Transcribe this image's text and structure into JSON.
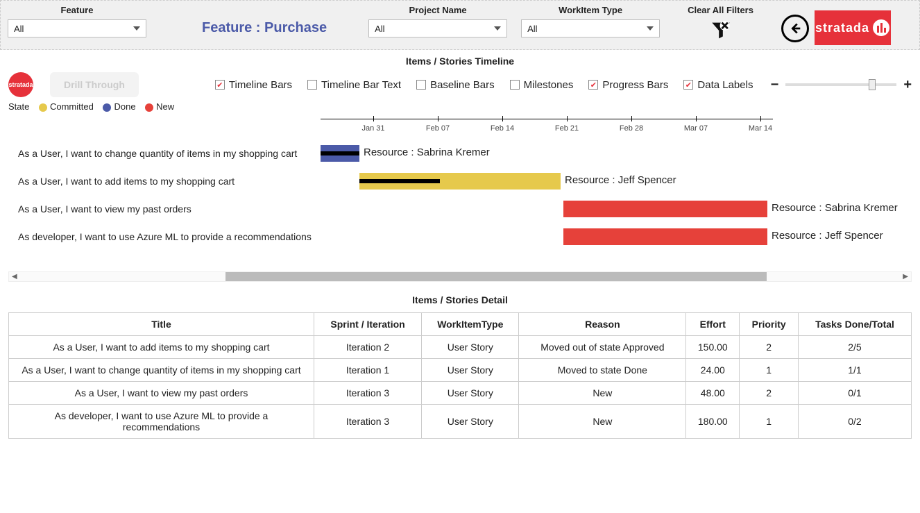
{
  "header": {
    "filters": {
      "feature": {
        "label": "Feature",
        "value": "All"
      },
      "project": {
        "label": "Project Name",
        "value": "All"
      },
      "workitem": {
        "label": "WorkItem Type",
        "value": "All"
      }
    },
    "feature_title": "Feature : Purchase",
    "clear_label": "Clear All Filters",
    "brand": "stratada"
  },
  "timeline": {
    "title": "Items / Stories Timeline",
    "drill_label": "Drill Through",
    "checks": [
      {
        "label": "Timeline Bars",
        "checked": true
      },
      {
        "label": "Timeline Bar Text",
        "checked": false
      },
      {
        "label": "Baseline Bars",
        "checked": false
      },
      {
        "label": "Milestones",
        "checked": false
      },
      {
        "label": "Progress Bars",
        "checked": true
      },
      {
        "label": "Data Labels",
        "checked": true
      }
    ],
    "legend": {
      "title": "State",
      "items": [
        {
          "label": "Committed",
          "color": "#e6c94c"
        },
        {
          "label": "Done",
          "color": "#4b5aa8"
        },
        {
          "label": "New",
          "color": "#e6413a"
        }
      ]
    },
    "axis_ticks": [
      "Jan 31",
      "Feb 07",
      "Feb 14",
      "Feb 21",
      "Feb 28",
      "Mar 07",
      "Mar 14"
    ],
    "rows": [
      {
        "label": "As a User, I want to change quantity of items in my shopping cart",
        "data_label": "Resource : Sabrina Kremer"
      },
      {
        "label": "As a User, I want to add items to my shopping cart",
        "data_label": "Resource : Jeff Spencer"
      },
      {
        "label": "As a User, I want to view my past orders",
        "data_label": "Resource : Sabrina Kremer"
      },
      {
        "label": "As developer, I want to use Azure ML to provide a recommendations",
        "data_label": "Resource : Jeff Spencer"
      }
    ]
  },
  "detail": {
    "title": "Items / Stories Detail",
    "columns": [
      "Title",
      "Sprint / Iteration",
      "WorkItemType",
      "Reason",
      "Effort",
      "Priority",
      "Tasks Done/Total"
    ],
    "rows": [
      [
        "As a User, I want to add items to my shopping cart",
        "Iteration 2",
        "User Story",
        "Moved out of state Approved",
        "150.00",
        "2",
        "2/5"
      ],
      [
        "As a User, I want to change quantity of items in my shopping cart",
        "Iteration 1",
        "User Story",
        "Moved to state Done",
        "24.00",
        "1",
        "1/1"
      ],
      [
        "As a User, I want to view my past orders",
        "Iteration 3",
        "User Story",
        "New",
        "48.00",
        "2",
        "0/1"
      ],
      [
        "As developer, I want to use Azure ML to provide a recommendations",
        "Iteration 3",
        "User Story",
        "New",
        "180.00",
        "1",
        "0/2"
      ]
    ]
  },
  "chart_data": {
    "type": "gantt",
    "title": "Items / Stories Timeline",
    "x_axis_dates": [
      "Jan 31",
      "Feb 07",
      "Feb 14",
      "Feb 21",
      "Feb 28",
      "Mar 07",
      "Mar 14"
    ],
    "state_colors": {
      "Committed": "#e6c94c",
      "Done": "#4b5aa8",
      "New": "#e6413a"
    },
    "tasks": [
      {
        "title": "As a User, I want to change quantity of items in my shopping cart",
        "state": "Done",
        "start": "Jan 28",
        "end": "Feb 02",
        "progress": 1.0,
        "resource": "Sabrina Kremer"
      },
      {
        "title": "As a User, I want to add items to my shopping cart",
        "state": "Committed",
        "start": "Feb 01",
        "end": "Feb 22",
        "progress": 0.4,
        "resource": "Jeff Spencer"
      },
      {
        "title": "As a User, I want to view my past orders",
        "state": "New",
        "start": "Feb 22",
        "end": "Mar 15",
        "progress": 0.0,
        "resource": "Sabrina Kremer"
      },
      {
        "title": "As developer, I want to use Azure ML to provide a recommendations",
        "state": "New",
        "start": "Feb 22",
        "end": "Mar 15",
        "progress": 0.0,
        "resource": "Jeff Spencer"
      }
    ]
  }
}
